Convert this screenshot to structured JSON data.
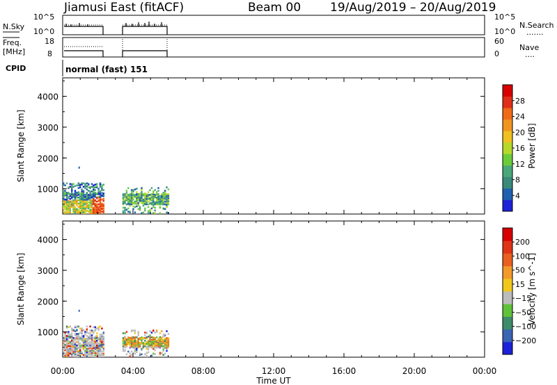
{
  "header": {
    "title": "Jiamusi East (fitACF)",
    "beam": "Beam 00",
    "dates": "19/Aug/2019 – 20/Aug/2019"
  },
  "noise_panel": {
    "left_label": "N.Sky",
    "left_ticks": [
      "10^5",
      "10^0"
    ],
    "right_ticks": [
      "10^5",
      "10^0"
    ],
    "right_label": "N.Search",
    "right_legend": "......."
  },
  "freq_panel": {
    "left_label_1": "Freq.",
    "left_label_2": "[MHz]",
    "left_ticks": [
      "18",
      "8"
    ],
    "right_ticks": [
      "60",
      "0"
    ],
    "right_label": "Nave",
    "right_legend": "...."
  },
  "cpid": {
    "label": "CPID",
    "value": "normal (fast) 151"
  },
  "x_axis": {
    "label": "Time UT",
    "ticks": [
      "00:00",
      "04:00",
      "08:00",
      "12:00",
      "16:00",
      "20:00",
      "00:00"
    ]
  },
  "chart_data": [
    {
      "type": "heatmap",
      "name": "power",
      "ylabel": "Slant Range [km]",
      "yticks": [
        1000,
        2000,
        3000,
        4000
      ],
      "ylim": [
        180,
        4600
      ],
      "xlim_hours": [
        0,
        24
      ],
      "data_hours": [
        [
          0.0,
          2.3
        ],
        [
          3.4,
          6.0
        ]
      ],
      "colorbar": {
        "label": "Power [dB]",
        "ticks": [
          4,
          8,
          12,
          16,
          20,
          24,
          28
        ],
        "colors": [
          "#1c22d8",
          "#1f5fb0",
          "#3a8a7a",
          "#4aa77a",
          "#6bcc3a",
          "#b6d82a",
          "#f0c020",
          "#f09420",
          "#f06a18",
          "#e02f18",
          "#d80000"
        ]
      }
    },
    {
      "type": "heatmap",
      "name": "velocity",
      "ylabel": "Slant Range [km]",
      "yticks": [
        1000,
        2000,
        3000,
        4000
      ],
      "ylim": [
        180,
        4600
      ],
      "xlim_hours": [
        0,
        24
      ],
      "data_hours": [
        [
          0.0,
          2.3
        ],
        [
          3.4,
          6.0
        ]
      ],
      "colorbar": {
        "label": "Velocity [m s^-1]",
        "ticks": [
          200,
          100,
          50,
          15,
          -15,
          -50,
          -100,
          -200
        ],
        "colors": [
          "#1c22d8",
          "#3a64b4",
          "#3f8c6a",
          "#5fc23a",
          "#bcbcbc",
          "#f2c71c",
          "#f2992a",
          "#ea6020",
          "#e03418",
          "#d80000"
        ]
      }
    }
  ]
}
